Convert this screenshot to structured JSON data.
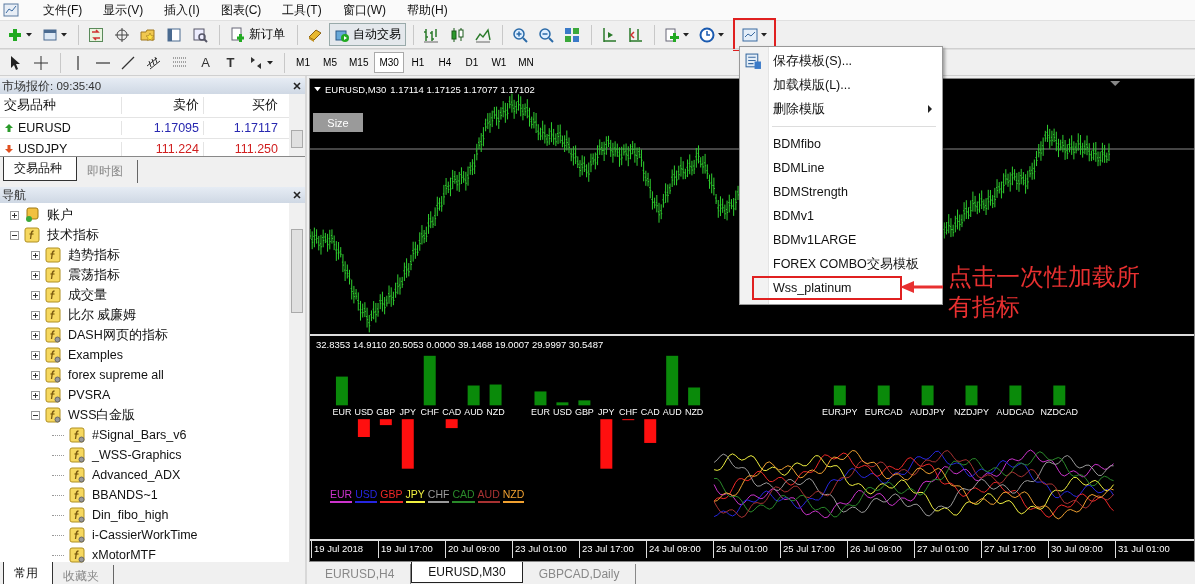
{
  "menu_bar": [
    "文件(F)",
    "显示(V)",
    "插入(I)",
    "图表(C)",
    "工具(T)",
    "窗口(W)",
    "帮助(H)"
  ],
  "toolbar": {
    "new_order": "新订单",
    "auto_trading": {
      "label": "自动交易",
      "on": true
    },
    "templates_boxed": true
  },
  "drawing_tools": {
    "text": "A",
    "text_label": "T"
  },
  "timeframes": [
    {
      "label": "M1",
      "selected": false
    },
    {
      "label": "M5",
      "selected": false
    },
    {
      "label": "M15",
      "selected": false
    },
    {
      "label": "M30",
      "selected": true
    },
    {
      "label": "H1",
      "selected": false
    },
    {
      "label": "H4",
      "selected": false
    },
    {
      "label": "D1",
      "selected": false
    },
    {
      "label": "W1",
      "selected": false
    },
    {
      "label": "MN",
      "selected": false
    }
  ],
  "market_watch": {
    "title": "市场报价: 09:35:40",
    "columns": [
      "交易品种",
      "卖价",
      "买价"
    ],
    "rows": [
      {
        "symbol": "EURUSD",
        "kind": "up",
        "bid": "1.17095",
        "ask": "1.17117"
      },
      {
        "symbol": "USDJPY",
        "kind": "down",
        "bid": "111.224",
        "ask": "111.250"
      }
    ],
    "tabs": [
      {
        "label": "交易品种",
        "selected": true
      },
      {
        "label": "即时图",
        "selected": false
      }
    ]
  },
  "navigator": {
    "title": "导航",
    "tree": [
      {
        "label": "账户",
        "kind": "account",
        "expanded": false
      },
      {
        "label": "技术指标",
        "kind": "builtin",
        "expanded": true,
        "children": [
          {
            "label": "趋势指标",
            "kind": "builtin",
            "expanded": false
          },
          {
            "label": "震荡指标",
            "kind": "builtin",
            "expanded": false
          },
          {
            "label": "成交量",
            "kind": "builtin",
            "expanded": false
          },
          {
            "label": "比尔 威廉姆",
            "kind": "builtin",
            "expanded": false
          },
          {
            "label": "DASH网页的指标",
            "kind": "custom",
            "expanded": false
          },
          {
            "label": "Examples",
            "kind": "custom",
            "expanded": false
          },
          {
            "label": "forex supreme all",
            "kind": "custom",
            "expanded": false
          },
          {
            "label": "PVSRA",
            "kind": "custom",
            "expanded": false
          },
          {
            "label": "WSS白金版",
            "kind": "custom",
            "expanded": true,
            "children": [
              {
                "label": "#Signal_Bars_v6",
                "kind": "custom"
              },
              {
                "label": "_WSS-Graphics",
                "kind": "custom"
              },
              {
                "label": "Advanced_ADX",
                "kind": "custom"
              },
              {
                "label": "BBANDS~1",
                "kind": "custom"
              },
              {
                "label": "Din_fibo_high",
                "kind": "custom"
              },
              {
                "label": "i-CassierWorkTime",
                "kind": "custom"
              },
              {
                "label": "xMotorMTF",
                "kind": "custom"
              }
            ]
          }
        ]
      }
    ],
    "tabs": [
      {
        "label": "常用",
        "selected": true
      },
      {
        "label": "收藏夹",
        "selected": false
      }
    ]
  },
  "chart": {
    "symbol": "EURUSD,M30",
    "ohlc": "1.17114 1.17125 1.17077 1.17102",
    "size_button": "Size",
    "indicator": {
      "values": "32.8353 14.9110 20.5053 0.0000 39.1468 19.0007 29.9997 30.5487",
      "bar_groups": [
        [
          "EUR",
          "USD",
          "GBP",
          "JPY",
          "CHF",
          "CAD",
          "AUD",
          "NZD"
        ],
        [
          "EUR",
          "USD",
          "GBP",
          "JPY",
          "CHF",
          "CAD",
          "AUD",
          "NZD"
        ]
      ],
      "pairs": [
        "EURJPY",
        "EURCAD",
        "AUDJPY",
        "NZDJPY",
        "AUDCAD",
        "NZDCAD"
      ],
      "legend": [
        {
          "label": "EUR",
          "color": "#cc33cc"
        },
        {
          "label": "USD",
          "color": "#2626e0"
        },
        {
          "label": "GBP",
          "color": "#f02828"
        },
        {
          "label": "JPY",
          "color": "#f0f040"
        },
        {
          "label": "CHF",
          "color": "#9a9a9a"
        },
        {
          "label": "CAD",
          "color": "#2a8a2a"
        },
        {
          "label": "AUD",
          "color": "#a83232"
        },
        {
          "label": "NZD",
          "color": "#f0a030"
        }
      ]
    },
    "time_axis": [
      "19 Jul 2018",
      "19 Jul 17:00",
      "20 Jul 09:00",
      "23 Jul 01:00",
      "23 Jul 17:00",
      "24 Jul 09:00",
      "25 Jul 01:00",
      "25 Jul 17:00",
      "26 Jul 09:00",
      "27 Jul 01:00",
      "27 Jul 17:00",
      "30 Jul 09:00",
      "31 Jul 01:00"
    ]
  },
  "chart_tabs": [
    {
      "label": "EURUSD,H4",
      "selected": false
    },
    {
      "label": "EURUSD,M30",
      "selected": true
    },
    {
      "label": "GBPCAD,Daily",
      "selected": false
    }
  ],
  "template_menu": {
    "items": [
      {
        "kind": "save",
        "label": "保存模板(S)..."
      },
      {
        "kind": "action",
        "label": "加载模版(L)..."
      },
      {
        "kind": "submenu",
        "label": "删除模版"
      },
      {
        "kind": "separator"
      },
      {
        "kind": "template",
        "label": "BDMfibo",
        "boxed": false
      },
      {
        "kind": "template",
        "label": "BDMLine",
        "boxed": false
      },
      {
        "kind": "template",
        "label": "BDMStrength",
        "boxed": false
      },
      {
        "kind": "template",
        "label": "BDMv1",
        "boxed": false
      },
      {
        "kind": "template",
        "label": "BDMv1LARGE",
        "boxed": false
      },
      {
        "kind": "template",
        "label": "FOREX COMBO交易模板",
        "boxed": false
      },
      {
        "kind": "template",
        "label": "Wss_platinum",
        "boxed": true
      }
    ]
  },
  "annotation": {
    "text": "点击一次性加载所有指标"
  }
}
